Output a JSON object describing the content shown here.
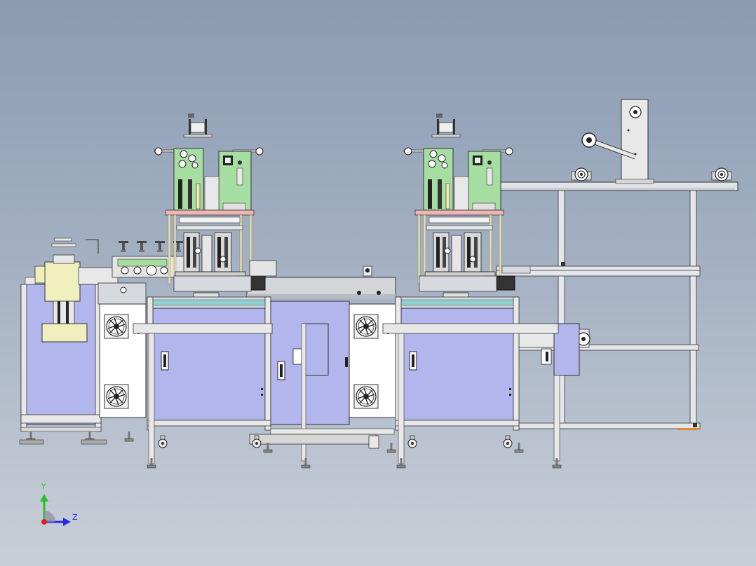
{
  "triad": {
    "y_label": "Y",
    "z_label": "Z"
  },
  "colors": {
    "background_top": "#8a9bb2",
    "background_bottom": "#c9cfd8",
    "panel_lavender": "#b3b6ec",
    "frame_metal": "#d6d9de",
    "green_unit": "#a6dea2",
    "cream_unit": "#f1efbe",
    "pink_plate": "#f0b4b4",
    "yellow_rods": "#e8e0a2",
    "outline": "#2e2e2e",
    "axis_y": "#25c225",
    "axis_z": "#2a2ae6",
    "axis_origin": "#e02020"
  }
}
